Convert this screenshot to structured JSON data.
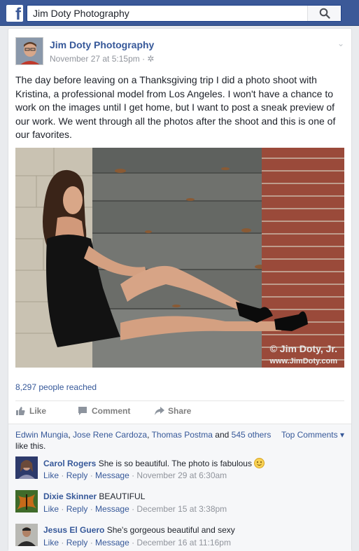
{
  "search": {
    "value": "Jim Doty Photography"
  },
  "post": {
    "page_name": "Jim Doty Photography",
    "time": "November 27 at 5:15pm · ",
    "privacy_icon": "gear-icon",
    "text": "The day before leaving on a Thanksgiving trip I did a photo shoot with Kristina, a professional model from Los Angeles. I won't have a chance to work on the images until I get home, but I want to post a sneak preview of our work. We went through all the photos after the shoot and this is one of our favorites.",
    "watermark_line1": "© Jim Doty, Jr.",
    "watermark_line2": "www.JimDoty.com",
    "reach_count": "8,297 people reached"
  },
  "actions": {
    "like": "Like",
    "comment": "Comment",
    "share": "Share"
  },
  "likes": {
    "name1": "Edwin Mungia",
    "sep1": ", ",
    "name2": "Jose Rene Cardoza",
    "sep2": ", ",
    "name3": "Thomas Postma",
    "and_text": " and ",
    "others": "545 others",
    "suffix": " like this.",
    "top_comments": "Top Comments ▾"
  },
  "comments": [
    {
      "name": "Carol Rogers",
      "text": " She is so beautiful. The photo is fabulous",
      "like": "Like",
      "reply": "Reply",
      "message": "Message",
      "sep": " · ",
      "date": "November 29 at 6:30am"
    },
    {
      "name": "Dixie Skinner",
      "text": " BEAUTIFUL",
      "like": "Like",
      "reply": "Reply",
      "message": "Message",
      "sep": " · ",
      "date": "December 15 at 3:38pm"
    },
    {
      "name": "Jesus El Guero",
      "text": " She's gorgeous beautiful and sexy",
      "like": "Like",
      "reply": "Reply",
      "message": "Message",
      "sep": " · ",
      "date": "December 16 at 11:16pm"
    }
  ],
  "colors": {
    "brand": "#3b5998",
    "link": "#365899",
    "meta": "#90949c"
  }
}
